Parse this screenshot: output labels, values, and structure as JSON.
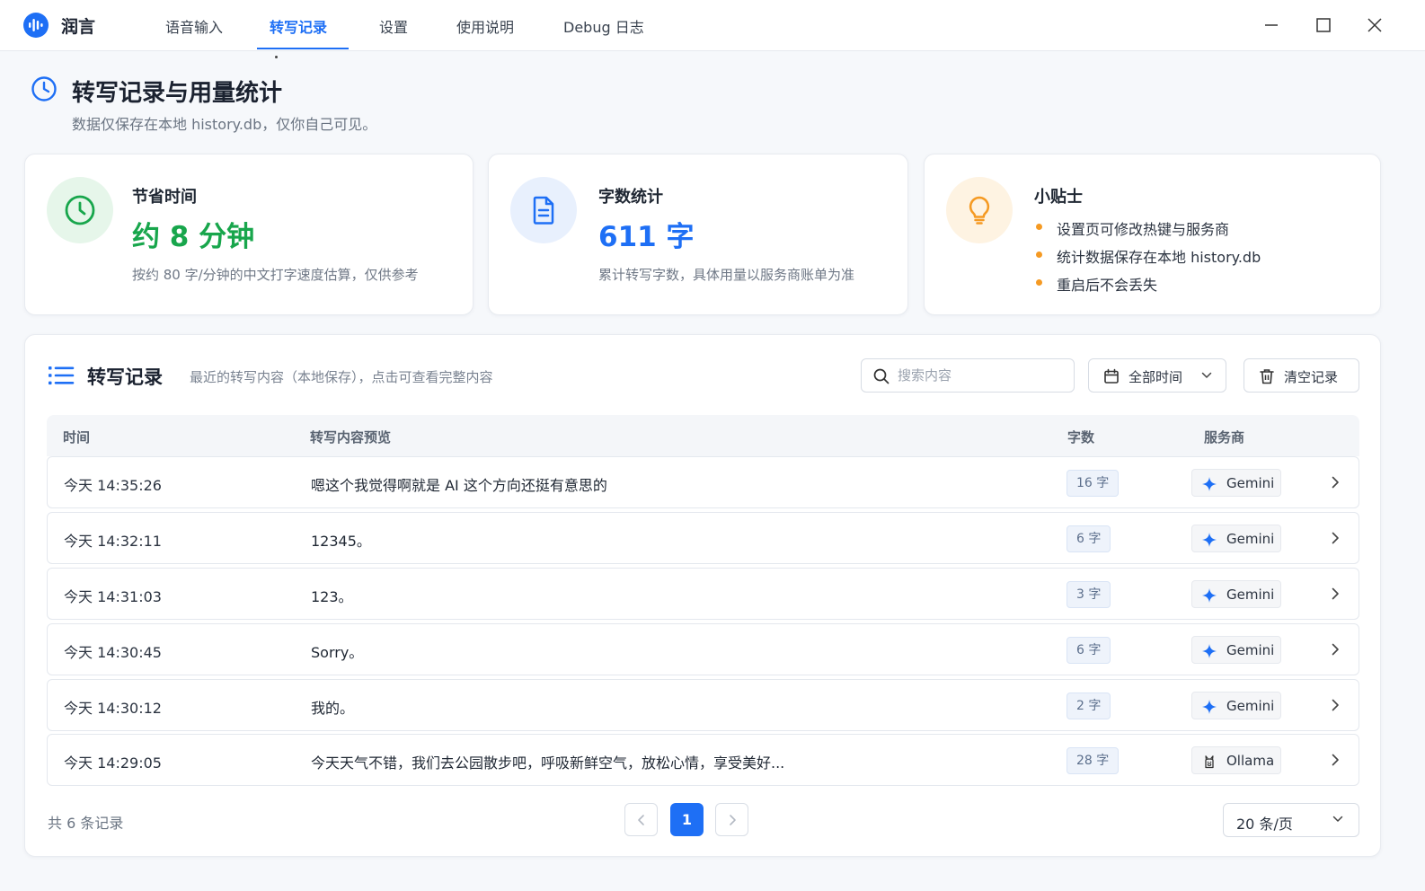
{
  "app": {
    "name": "润言"
  },
  "nav": {
    "tabs": [
      {
        "label": "语音输入",
        "active": false
      },
      {
        "label": "转写记录",
        "active": true
      },
      {
        "label": "设置",
        "active": false
      },
      {
        "label": "使用说明",
        "active": false
      },
      {
        "label": "Debug 日志",
        "active": false
      }
    ]
  },
  "window_controls": [
    "minimize-icon",
    "maximize-icon",
    "close-icon"
  ],
  "page": {
    "title": "转写记录与用量统计",
    "subtitle": "数据仅保存在本地 history.db，仅你自己可见。"
  },
  "stats": {
    "time_saved": {
      "label": "节省时间",
      "value": "约 8 分钟",
      "note": "按约 80 字/分钟的中文打字速度估算，仅供参考",
      "icon": "clock-icon",
      "color": "#18a64c"
    },
    "word_count": {
      "label": "字数统计",
      "value": "611 字",
      "note": "累计转写字数，具体用量以服务商账单为准",
      "icon": "document-icon",
      "color": "#1e6ff5"
    },
    "tips": {
      "label": "小贴士",
      "icon": "lightbulb-icon",
      "color": "#f59a23",
      "items": [
        "设置页可修改热键与服务商",
        "统计数据保存在本地 history.db",
        "重启后不会丢失"
      ]
    }
  },
  "records": {
    "title": "转写记录",
    "description": "最近的转写内容（本地保存），点击可查看完整内容",
    "search_placeholder": "搜索内容",
    "time_filter": "全部时间",
    "clear_label": "清空记录",
    "columns": [
      "时间",
      "转写内容预览",
      "字数",
      "服务商"
    ],
    "rows": [
      {
        "time": "今天  14:35:26",
        "text": "嗯这个我觉得啊就是 AI 这个方向还挺有意思的",
        "count": "16 字",
        "provider": "Gemini"
      },
      {
        "time": "今天  14:32:11",
        "text": "12345。",
        "count": "6 字",
        "provider": "Gemini"
      },
      {
        "time": "今天  14:31:03",
        "text": "123。",
        "count": "3 字",
        "provider": "Gemini"
      },
      {
        "time": "今天  14:30:45",
        "text": "Sorry。",
        "count": "6 字",
        "provider": "Gemini"
      },
      {
        "time": "今天  14:30:12",
        "text": "我的。",
        "count": "2 字",
        "provider": "Gemini"
      },
      {
        "time": "今天  14:29:05",
        "text": "今天天气不错，我们去公园散步吧，呼吸新鲜空气，放松心情，享受美好...",
        "count": "28 字",
        "provider": "Ollama"
      }
    ],
    "total": "共 6 条记录",
    "current_page": "1",
    "page_size": "20 条/页"
  },
  "colors": {
    "accent": "#1e6ff5",
    "success": "#18a64c",
    "warning": "#f59a23"
  }
}
